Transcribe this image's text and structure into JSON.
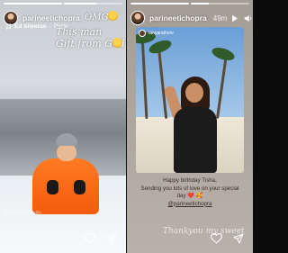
{
  "left_story": {
    "progress": [
      1,
      0.55
    ],
    "username": "parineetichopra",
    "music": {
      "artist": "Ed Sheeran",
      "title": "Perfe"
    },
    "overlay_text": {
      "omg": "OMG",
      "this_man": "This man",
      "gift": "Gift from God"
    },
    "watermark": "@ankityadavforlife"
  },
  "right_story": {
    "progress": [
      1,
      0.3
    ],
    "username": "parineetichopra",
    "timestamp": "49m",
    "repost_user": "tanyarathore",
    "caption": {
      "line1": "Happy birthday Tisha,",
      "line2": "Sending you lots of love on your special",
      "line3": "day ❤️ 🥰",
      "line4": "@parineetichopra"
    },
    "bottom_text": "Thankyou my sweet"
  },
  "icons": {
    "heart": "heart-icon",
    "share": "send-icon",
    "play": "play-icon",
    "mute": "speaker-icon",
    "more": "more-icon"
  }
}
